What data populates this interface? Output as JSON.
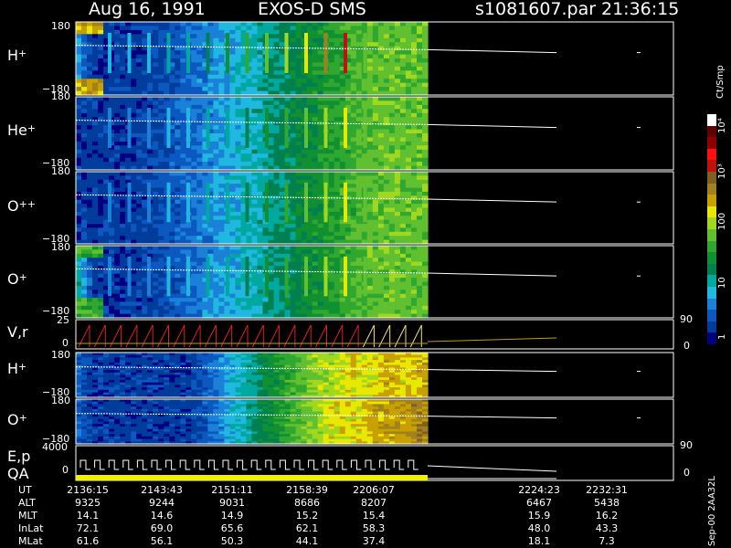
{
  "header": {
    "date": "Aug 16, 1991",
    "instrument": "EXOS-D SMS",
    "file": "s1081607.par",
    "time": "21:36:15"
  },
  "colorbar": {
    "unit": "Ct/Smp",
    "labels": [
      "1",
      "10",
      "100",
      "10³",
      "10⁴"
    ],
    "colors": [
      "#000080",
      "#003c9c",
      "#0a58c0",
      "#1a80d8",
      "#20b8e0",
      "#00a8a0",
      "#008050",
      "#109030",
      "#30a830",
      "#60c030",
      "#a0d820",
      "#e8e800",
      "#c8a000",
      "#a08020",
      "#806020",
      "#c01010",
      "#ff1010",
      "#900000",
      "#600000",
      "#ffffff"
    ]
  },
  "panels": [
    {
      "id": "h-plus",
      "label": "H",
      "sup": "+",
      "ymax": "180",
      "ymin": "−180"
    },
    {
      "id": "he-plus",
      "label": "He",
      "sup": "+",
      "ymax": "180",
      "ymin": "−180"
    },
    {
      "id": "o-plusplus",
      "label": "O",
      "sup": "++",
      "ymax": "180",
      "ymin": "−180"
    },
    {
      "id": "o-plus",
      "label": "O",
      "sup": "+",
      "ymax": "180",
      "ymin": "−180"
    },
    {
      "id": "v-r",
      "label": "V,r",
      "sup": "",
      "ymax": "25",
      "ymin": "0",
      "right_top": "90",
      "right_bottom": "0"
    },
    {
      "id": "h-plus-2",
      "label": "H",
      "sup": "+",
      "ymax": "180",
      "ymin": "−180"
    },
    {
      "id": "o-plus-2",
      "label": "O",
      "sup": "+",
      "ymax": "180",
      "ymin": "−180"
    },
    {
      "id": "e-p-qa",
      "label": "E,p",
      "label2": "QA",
      "sup": "",
      "ymax": "4000",
      "ymin": "0",
      "right_top": "90",
      "right_bottom": "0"
    }
  ],
  "side_annotation": "Sep-00  2AA32L",
  "footer": {
    "row_labels": [
      "UT",
      "ALT",
      "MLT",
      "InLat",
      "MLat"
    ],
    "columns": [
      {
        "UT": "2136:15",
        "ALT": "9325",
        "MLT": "14.1",
        "InLat": "72.1",
        "MLat": "61.6"
      },
      {
        "UT": "2143:43",
        "ALT": "9244",
        "MLT": "14.6",
        "InLat": "69.0",
        "MLat": "56.1"
      },
      {
        "UT": "2151:11",
        "ALT": "9031",
        "MLT": "14.9",
        "InLat": "65.6",
        "MLat": "50.3"
      },
      {
        "UT": "2158:39",
        "ALT": "8686",
        "MLT": "15.2",
        "InLat": "62.1",
        "MLat": "44.1"
      },
      {
        "UT": "2206:07",
        "ALT": "8207",
        "MLT": "15.4",
        "InLat": "58.3",
        "MLat": "37.4"
      },
      {
        "UT": "2224:23",
        "ALT": "6467",
        "MLT": "15.9",
        "InLat": "48.0",
        "MLat": "18.1"
      },
      {
        "UT": "2232:31",
        "ALT": "5438",
        "MLT": "16.2",
        "InLat": "43.3",
        "MLat": "7.3"
      }
    ]
  },
  "chart_data": {
    "type": "heatmap",
    "x_label": "UT",
    "x_ticks": [
      "2136:15",
      "2143:43",
      "2151:11",
      "2158:39",
      "2206:07",
      "2224:23",
      "2232:31"
    ],
    "series": [
      {
        "name": "H+",
        "y_range": [
          -180,
          180
        ],
        "level_profile": [
          3.5,
          1,
          1,
          1,
          1,
          1.2,
          1.5,
          2,
          2.5,
          3,
          3.5,
          4,
          4.5,
          5,
          5.5,
          6,
          6.5,
          7,
          7.5,
          8,
          8.5,
          9,
          9,
          9,
          9,
          9,
          0
        ],
        "spike_levels": [
          4,
          4,
          4,
          5,
          5,
          6,
          7,
          8,
          9,
          10,
          11,
          13,
          15,
          9
        ]
      },
      {
        "name": "He+",
        "y_range": [
          -180,
          180
        ],
        "level_profile": [
          1,
          1,
          1,
          1,
          1,
          1.2,
          1.5,
          2,
          2.5,
          3,
          3.5,
          4,
          4.5,
          5,
          5.5,
          6,
          6.5,
          7,
          7.5,
          8,
          8.5,
          9,
          9,
          9,
          9,
          9,
          0
        ],
        "spike_levels": [
          3,
          3,
          3,
          4,
          4,
          5,
          5,
          6,
          7,
          8,
          9,
          10,
          11,
          9
        ]
      },
      {
        "name": "O++",
        "y_range": [
          -180,
          180
        ],
        "level_profile": [
          1,
          1,
          1,
          1,
          1,
          1.2,
          1.5,
          2,
          2.5,
          3,
          3.5,
          4,
          4.5,
          5,
          5.5,
          6,
          6.5,
          7,
          7.5,
          8,
          8.5,
          9,
          9,
          9,
          9,
          9,
          0
        ],
        "spike_levels": [
          3,
          3,
          3,
          4,
          4,
          5,
          5,
          6,
          7,
          8,
          9,
          10,
          11,
          9
        ]
      },
      {
        "name": "O+",
        "y_range": [
          -180,
          180
        ],
        "level_profile": [
          5,
          1,
          1,
          1,
          1,
          1.2,
          1.5,
          2,
          2.5,
          3,
          3.5,
          4,
          4.5,
          5,
          5.5,
          6,
          6.5,
          7,
          7.5,
          8,
          8.5,
          9,
          9,
          9,
          9,
          9,
          0
        ],
        "spike_levels": [
          3,
          3,
          3,
          4,
          4,
          5,
          5,
          6,
          7,
          8,
          9,
          10,
          11,
          9
        ]
      },
      {
        "name": "H+ (lower)",
        "y_range": [
          -180,
          180
        ],
        "level_profile": [
          2,
          1,
          1,
          1,
          1,
          1,
          1,
          1,
          1,
          2,
          3,
          4,
          5,
          6,
          7,
          8,
          9,
          10,
          10,
          11,
          11,
          11,
          12,
          11,
          12,
          12,
          0
        ],
        "spike_levels": []
      },
      {
        "name": "O+ (lower)",
        "y_range": [
          -180,
          180
        ],
        "level_profile": [
          2,
          1,
          1,
          1,
          1,
          1,
          1,
          1,
          1,
          2,
          3,
          4,
          5,
          6,
          7,
          8,
          9,
          10,
          11,
          11,
          11,
          12,
          12,
          12,
          13,
          13,
          0
        ],
        "spike_levels": []
      }
    ],
    "line_panels": [
      {
        "name": "V,r",
        "y_range": [
          0,
          25
        ],
        "right_axis": [
          0,
          90
        ],
        "ramp_count": 22
      },
      {
        "name": "E,p",
        "y_range": [
          0,
          4000
        ],
        "right_axis": [
          0,
          90
        ],
        "step_count": 24
      }
    ],
    "color_scale": {
      "label": "Ct/Smp",
      "scale": "log",
      "range": [
        1,
        10000
      ]
    }
  }
}
